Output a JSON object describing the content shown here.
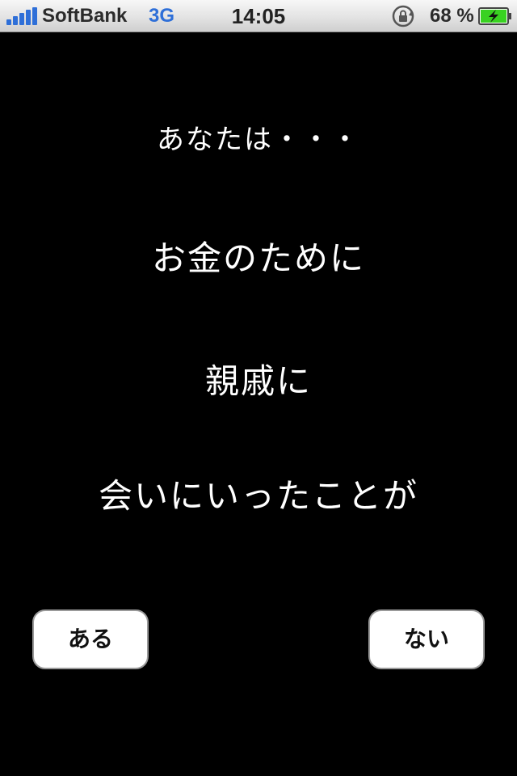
{
  "status_bar": {
    "carrier": "SoftBank",
    "network": "3G",
    "time": "14:05",
    "battery_percent": "68 %",
    "signal_icon": "signal-bars-icon",
    "lock_icon": "rotation-lock-icon",
    "battery_icon": "battery-charging-icon",
    "accent_color": "#2e6fd8",
    "battery_color": "#39d221"
  },
  "question": {
    "line1": "あなたは・・・",
    "line2": "お金のために",
    "line3": "親戚に",
    "line4": "会いにいったことが"
  },
  "buttons": {
    "yes_label": "ある",
    "no_label": "ない"
  }
}
